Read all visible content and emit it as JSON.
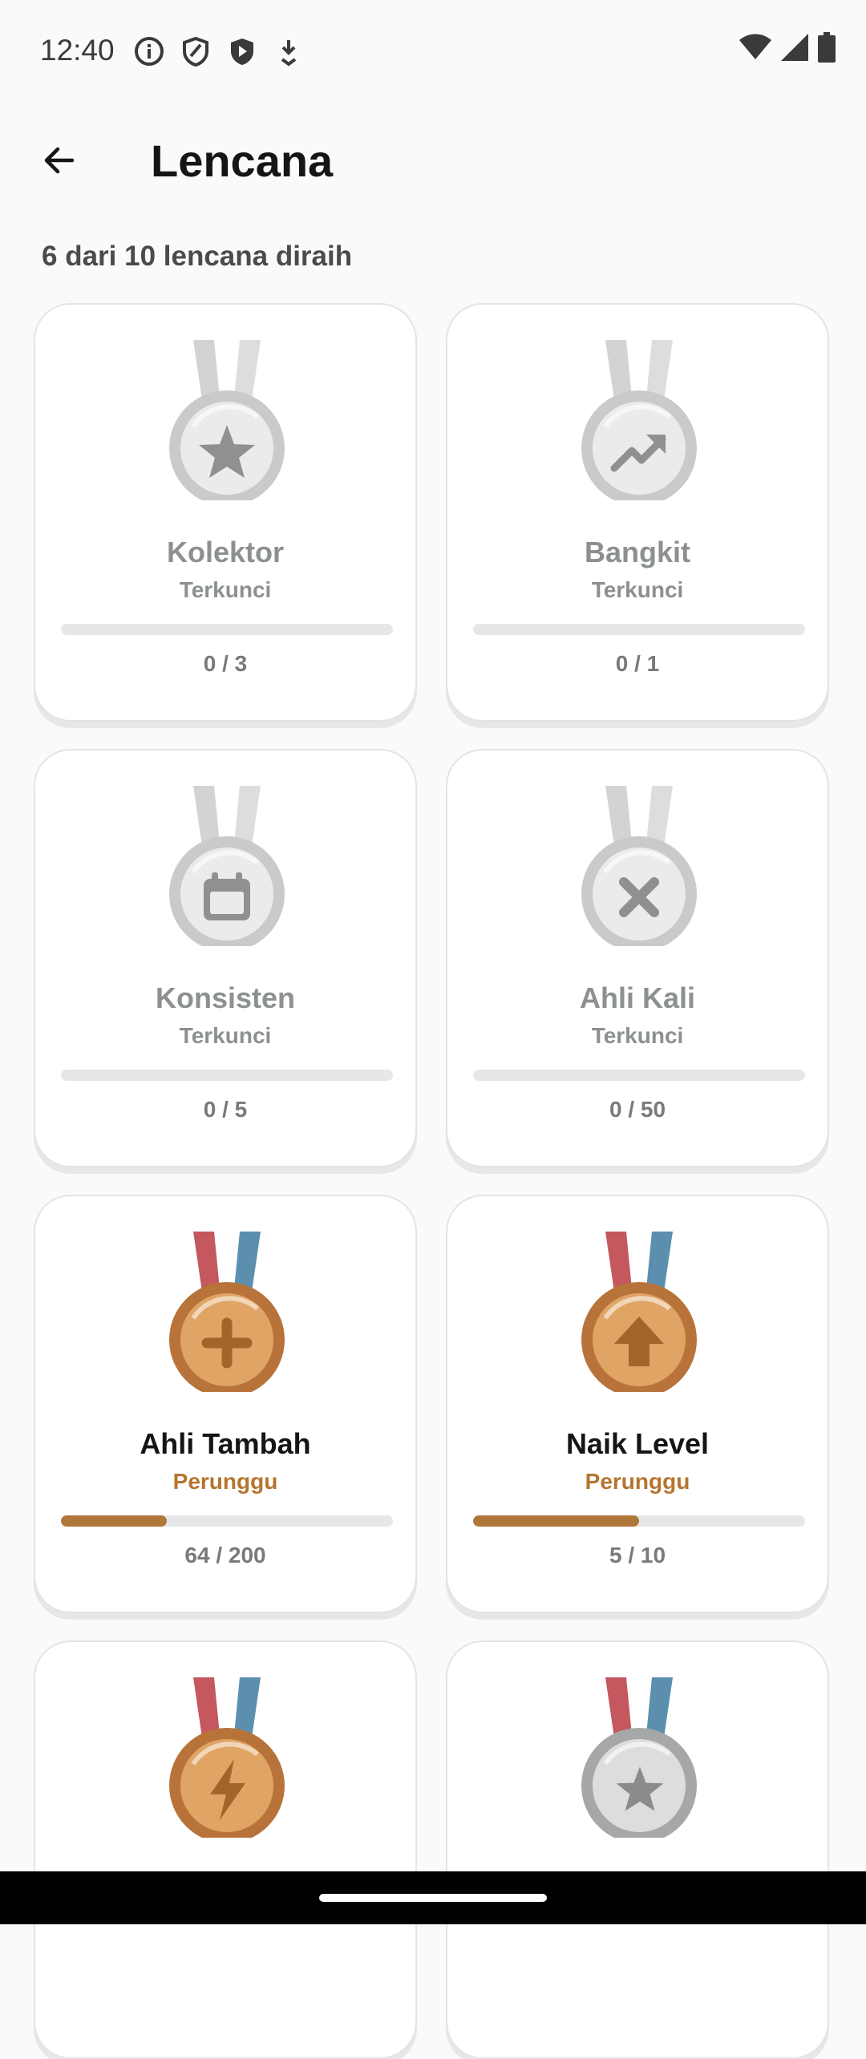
{
  "status_bar": {
    "time": "12:40",
    "left_icons": [
      "info-icon",
      "shield-outline-icon",
      "shield-filled-icon",
      "download-icon"
    ],
    "right_icons": [
      "wifi-icon",
      "signal-icon",
      "battery-icon"
    ]
  },
  "header": {
    "title": "Lencana",
    "back_icon": "arrow-back-icon"
  },
  "summary": "6 dari 10 lencana diraih",
  "colors": {
    "locked_text": "#8c9090",
    "earned_tier": "#b5752f",
    "progress_fill": "#b0773b",
    "progress_track": "#e7e7ea"
  },
  "badges": [
    {
      "name": "Kolektor",
      "tier": "Terkunci",
      "progress_text": "0 / 3",
      "progress": 0,
      "icon": "star-icon",
      "state": "locked"
    },
    {
      "name": "Bangkit",
      "tier": "Terkunci",
      "progress_text": "0 / 1",
      "progress": 0,
      "icon": "trending-up-icon",
      "state": "locked"
    },
    {
      "name": "Konsisten",
      "tier": "Terkunci",
      "progress_text": "0 / 5",
      "progress": 0,
      "icon": "calendar-icon",
      "state": "locked"
    },
    {
      "name": "Ahli Kali",
      "tier": "Terkunci",
      "progress_text": "0 / 50",
      "progress": 0,
      "icon": "multiply-icon",
      "state": "locked"
    },
    {
      "name": "Ahli Tambah",
      "tier": "Perunggu",
      "progress_text": "64 / 200",
      "progress": 0.32,
      "icon": "plus-icon",
      "state": "bronze"
    },
    {
      "name": "Naik Level",
      "tier": "Perunggu",
      "progress_text": "5 / 10",
      "progress": 0.5,
      "icon": "arrow-up-icon",
      "state": "bronze"
    },
    {
      "name": "",
      "tier": "",
      "progress_text": "",
      "progress": 0,
      "icon": "lightning-icon",
      "state": "bronze"
    },
    {
      "name": "",
      "tier": "",
      "progress_text": "",
      "progress": 0,
      "icon": "star-icon",
      "state": "silver"
    }
  ]
}
